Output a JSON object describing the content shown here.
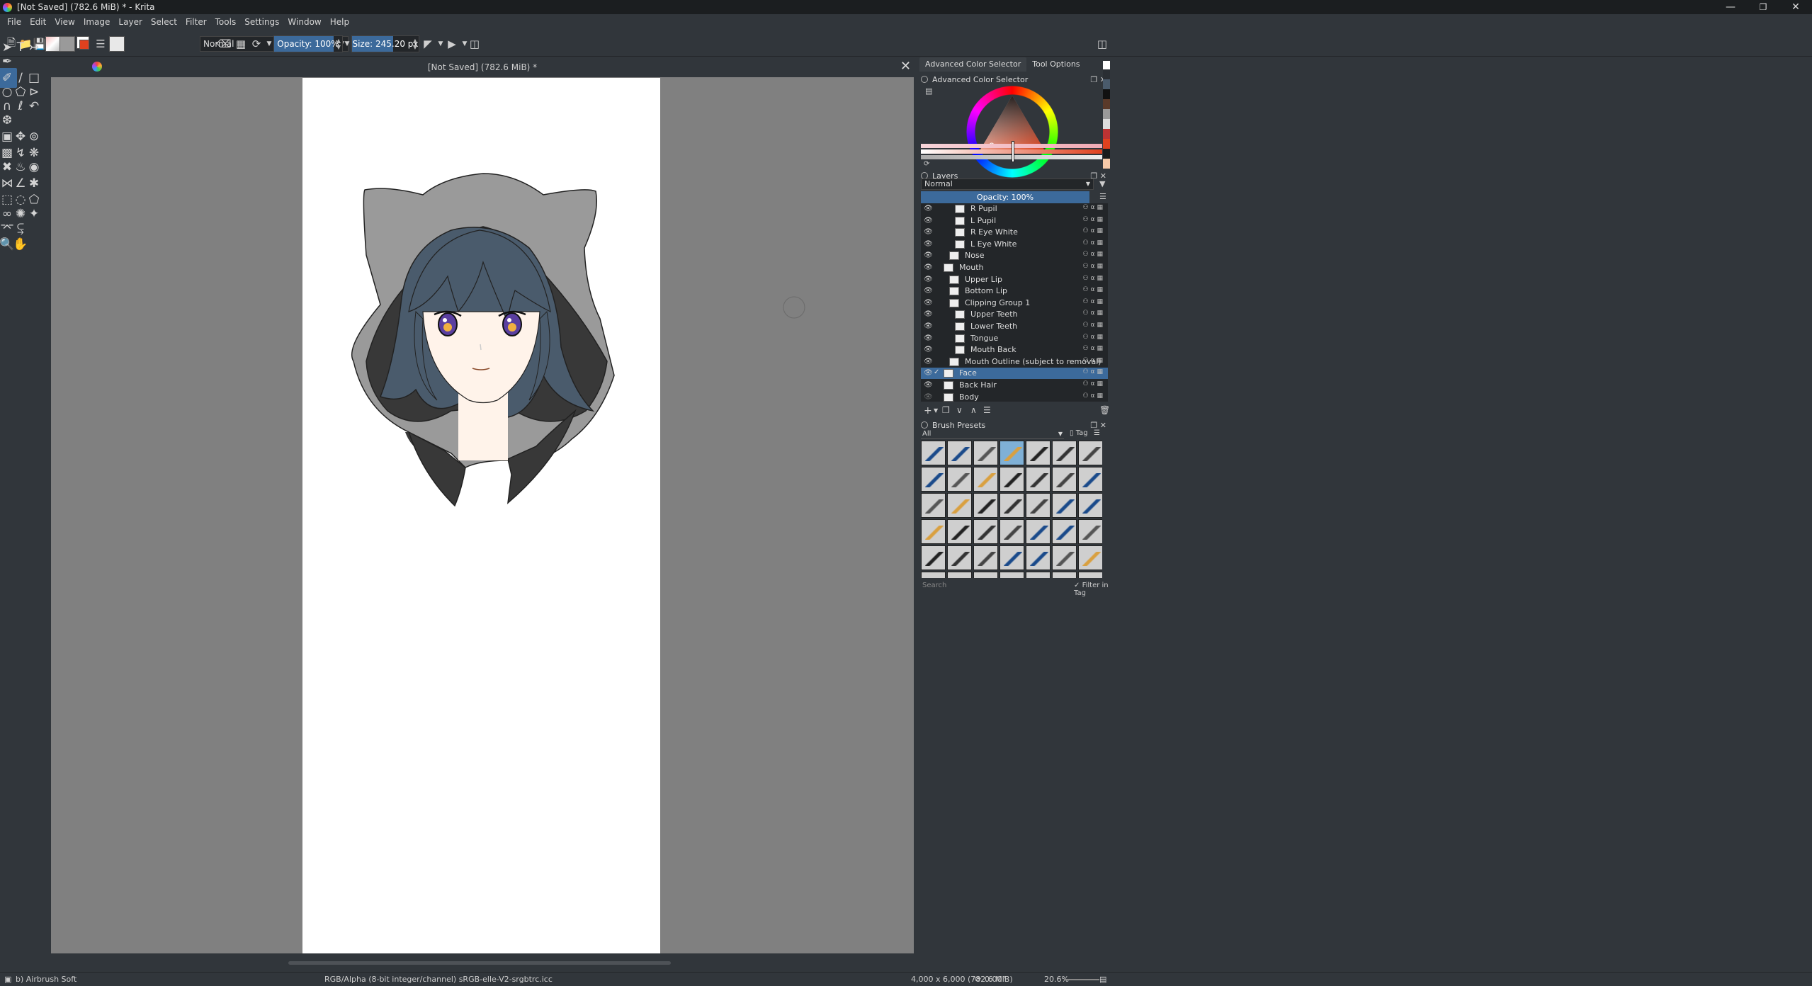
{
  "window": {
    "title": "[Not Saved]  (782.6 MiB) * - Krita"
  },
  "menu": [
    "File",
    "Edit",
    "View",
    "Image",
    "Layer",
    "Select",
    "Filter",
    "Tools",
    "Settings",
    "Window",
    "Help"
  ],
  "toolbar": {
    "blend_mode": "Normal",
    "opacity_label": "Opacity: 100%",
    "opacity_value": 1.0,
    "size_label": "Size: 245.20 px"
  },
  "document": {
    "tab_title": "[Not Saved]  (782.6 MiB) *"
  },
  "dock": {
    "tabs": [
      "Advanced Color Selector",
      "Tool Options"
    ],
    "color_selector_title": "Advanced Color Selector",
    "layers_title": "Layers",
    "layers_blend": "Normal",
    "layers_opacity": "Opacity:  100%",
    "brush_presets_title": "Brush Presets",
    "brush_filter": "All",
    "brush_tag": "Tag",
    "brush_search_placeholder": "Search",
    "filter_in_tag": "Filter in Tag"
  },
  "layers": [
    {
      "name": "R Pupil",
      "indent": 2,
      "selected": false,
      "checked": false
    },
    {
      "name": "L Pupil",
      "indent": 2,
      "selected": false,
      "checked": false
    },
    {
      "name": "R Eye White",
      "indent": 2,
      "selected": false,
      "checked": false
    },
    {
      "name": "L Eye White",
      "indent": 2,
      "selected": false,
      "checked": false
    },
    {
      "name": "Nose",
      "indent": 1,
      "selected": false,
      "checked": false
    },
    {
      "name": "Mouth",
      "indent": 0,
      "selected": false,
      "checked": false
    },
    {
      "name": "Upper Lip",
      "indent": 1,
      "selected": false,
      "checked": false
    },
    {
      "name": "Bottom Lip",
      "indent": 1,
      "selected": false,
      "checked": false
    },
    {
      "name": "Clipping Group 1",
      "indent": 1,
      "selected": false,
      "checked": false
    },
    {
      "name": "Upper Teeth",
      "indent": 2,
      "selected": false,
      "checked": false
    },
    {
      "name": "Lower Teeth",
      "indent": 2,
      "selected": false,
      "checked": false
    },
    {
      "name": "Tongue",
      "indent": 2,
      "selected": false,
      "checked": false
    },
    {
      "name": "Mouth Back",
      "indent": 2,
      "selected": false,
      "checked": false
    },
    {
      "name": "Mouth Outline (subject to removal)",
      "indent": 1,
      "selected": false,
      "checked": false
    },
    {
      "name": "Face",
      "indent": 0,
      "selected": true,
      "checked": true
    },
    {
      "name": "Back Hair",
      "indent": 0,
      "selected": false,
      "checked": false
    },
    {
      "name": "Body",
      "indent": 0,
      "selected": false,
      "checked": false
    }
  ],
  "status": {
    "brush": "b) Airbrush Soft",
    "color_profile": "RGB/Alpha (8-bit integer/channel)  sRGB-elle-V2-srgbtrc.icc",
    "dimensions": "4,000 x 6,000 (782.6 MiB)",
    "rotation": "0.00°",
    "zoom": "20.6%"
  },
  "colors": {
    "accent": "#3c6a9b",
    "bg": "#31363b",
    "canvas_bg": "#808080"
  }
}
